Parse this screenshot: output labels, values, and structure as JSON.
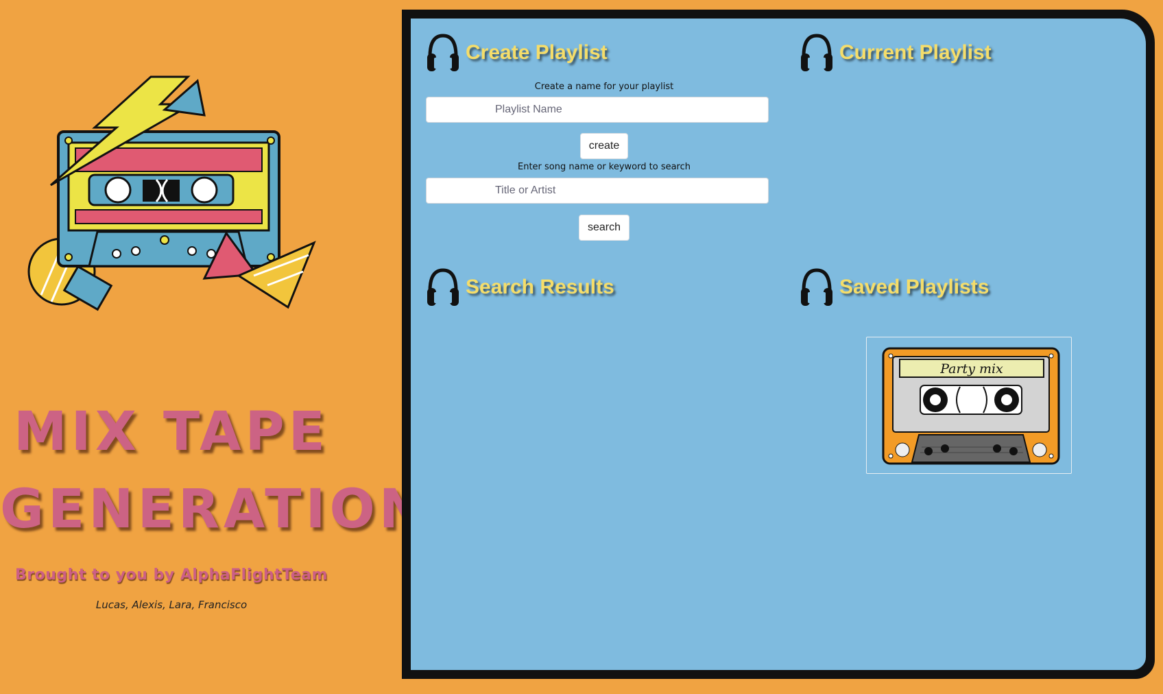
{
  "branding": {
    "title_line1": "MIX TAPE",
    "title_line2": "GENERATION",
    "byline": "Brought to you by AlphaFlightTeam",
    "credits": "Lucas, Alexis, Lara, Francisco"
  },
  "create_playlist": {
    "heading": "Create Playlist",
    "name_label": "Create a name for your playlist",
    "name_placeholder": "Playlist Name",
    "create_button": "create",
    "search_label": "Enter song name or keyword to search",
    "search_placeholder": "Title or Artist",
    "search_button": "search"
  },
  "current_playlist": {
    "heading": "Current Playlist"
  },
  "search_results": {
    "heading": "Search Results"
  },
  "saved_playlists": {
    "heading": "Saved Playlists",
    "items": [
      {
        "label": "Party mix"
      }
    ]
  },
  "icons": {
    "section_icon": "headphones-icon",
    "hero_art": "cassette-tape-illustration",
    "saved_item_art": "cassette-tape-icon"
  },
  "colors": {
    "page_background": "#f0a342",
    "panel_background": "#7fbbdf",
    "heading_yellow": "#f5dd6a",
    "brand_pink": "#cc6384"
  }
}
